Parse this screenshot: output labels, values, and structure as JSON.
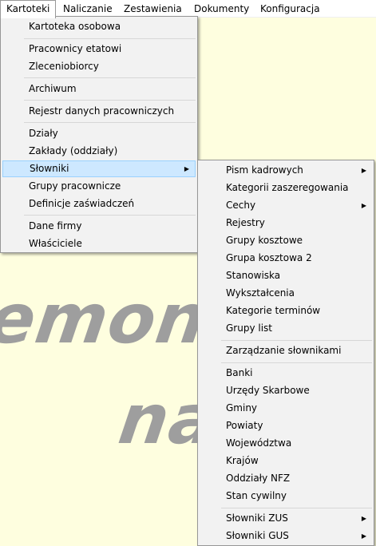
{
  "menubar": {
    "items": [
      "Kartoteki",
      "Naliczanie",
      "Zestawienia",
      "Dokumenty",
      "Konfiguracja"
    ]
  },
  "background": {
    "watermark_line1": "emonst",
    "watermark_line2": "na"
  },
  "kartoteki_menu": {
    "items": [
      "Kartoteka osobowa",
      "Pracownicy etatowi",
      "Zleceniobiorcy",
      "Archiwum",
      "Rejestr danych pracowniczych",
      "Działy",
      "Zakłady (oddziały)",
      "Słowniki",
      "Grupy pracownicze",
      "Definicje zaświadczeń",
      "Dane firmy",
      "Właściciele"
    ],
    "highlighted": "Słowniki"
  },
  "slowniki_menu": {
    "items": [
      "Pism kadrowych",
      "Kategorii zaszeregowania",
      "Cechy",
      "Rejestry",
      "Grupy kosztowe",
      "Grupa kosztowa 2",
      "Stanowiska",
      "Wykształcenia",
      "Kategorie terminów",
      "Grupy list",
      "Zarządzanie słownikami",
      "Banki",
      "Urzędy Skarbowe",
      "Gminy",
      "Powiaty",
      "Województwa",
      "Krajów",
      "Oddziały NFZ",
      "Stan cywilny",
      "Słowniki ZUS",
      "Słowniki GUS"
    ]
  },
  "icons": {
    "submenu_arrow": "▶"
  }
}
